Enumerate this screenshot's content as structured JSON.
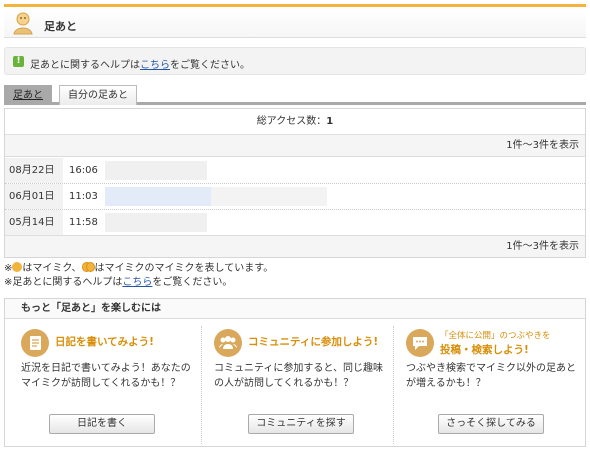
{
  "header": {
    "title": "足あと"
  },
  "help": {
    "prefix": "足あとに関するヘルプは",
    "link": "こちら",
    "suffix": "をご覧ください。"
  },
  "tabs": [
    {
      "label": "足あと",
      "active": true
    },
    {
      "label": "自分の足あと",
      "active": false
    }
  ],
  "summary": {
    "label": "総アクセス数：",
    "count": "1"
  },
  "pagination": {
    "top": "1件～3件を表示",
    "bottom": "1件～3件を表示"
  },
  "visits": [
    {
      "date": "08月22日",
      "time": "16:06"
    },
    {
      "date": "06月01日",
      "time": "11:03"
    },
    {
      "date": "05月14日",
      "time": "11:58"
    }
  ],
  "notes": {
    "line1_a": "※",
    "line1_b": "はマイミク、",
    "line1_c": "はマイミクのマイミクを表しています。",
    "line2_prefix": "※足あとに関するヘルプは",
    "line2_link": "こちら",
    "line2_suffix": "をご覧ください。"
  },
  "enjoy": {
    "title": "もっと「足あと」を楽しむには",
    "diary": {
      "title": "日記を書いてみよう!",
      "desc": "近況を日記で書いてみよう！あなたのマイミクが訪問してくれるかも！？",
      "button": "日記を書く"
    },
    "community": {
      "title": "コミュニティに参加しよう!",
      "desc": "コミュニティに参加すると、同じ趣味の人が訪問してくれるかも！？",
      "button": "コミュニティを探す"
    },
    "tweet": {
      "sub": "「全体に公開」のつぶやきを",
      "title": "投稿・検索しよう!",
      "desc": "つぶやき検索でマイミク以外の足あとが増えるかも！？",
      "button": "さっそく探してみる"
    }
  },
  "colors": {
    "accent": "#f2b43d",
    "link": "#2456a8",
    "orange_text": "#d98f0a"
  }
}
